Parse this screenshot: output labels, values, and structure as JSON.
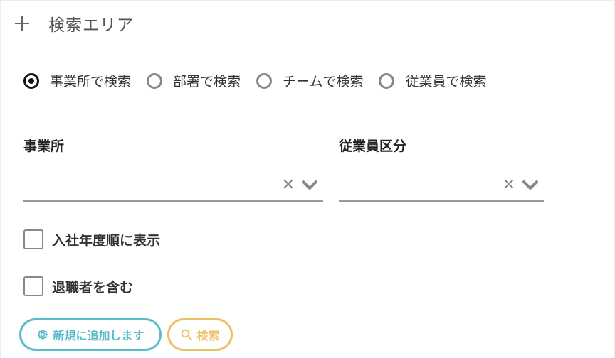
{
  "header": {
    "title": "検索エリア"
  },
  "search_mode": {
    "options": [
      {
        "label": "事業所で検索",
        "checked": true
      },
      {
        "label": "部署で検索",
        "checked": false
      },
      {
        "label": "チームで検索",
        "checked": false
      },
      {
        "label": "従業員で検索",
        "checked": false
      }
    ]
  },
  "fields": {
    "office": {
      "label": "事業所",
      "value": ""
    },
    "employee_type": {
      "label": "従業員区分",
      "value": ""
    }
  },
  "checkboxes": {
    "sort_by_join_year": {
      "label": "入社年度順に表示",
      "checked": false
    },
    "include_retired": {
      "label": "退職者を含む",
      "checked": false
    }
  },
  "buttons": {
    "add_new": "新規に追加します",
    "search": "検索"
  },
  "colors": {
    "add_button": "#5bbcc7",
    "search_button": "#ecc166"
  }
}
